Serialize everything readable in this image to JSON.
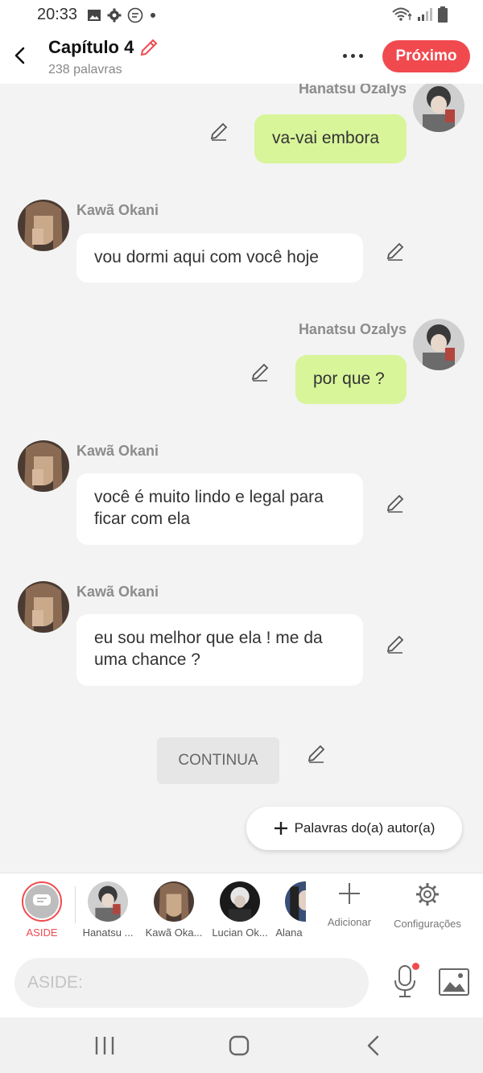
{
  "status_bar": {
    "time": "20:33"
  },
  "header": {
    "title": "Capítulo 4",
    "word_count": "238 palavras",
    "next_label": "Próximo"
  },
  "messages": [
    {
      "side": "right",
      "author": "Hanatsu Ozalys",
      "text": "va-vai embora"
    },
    {
      "side": "left",
      "author": "Kawã Okani",
      "text": "vou dormi aqui com você hoje"
    },
    {
      "side": "right",
      "author": "Hanatsu Ozalys",
      "text": "por que ?"
    },
    {
      "side": "left",
      "author": "Kawã Okani",
      "text": "você é muito lindo e legal para ficar com ela"
    },
    {
      "side": "left",
      "author": "Kawã Okani",
      "text": "eu sou melhor que ela ! me da uma chance ?"
    }
  ],
  "aside_text": "CONTINUA",
  "author_words_label": "Palavras do(a) autor(a)",
  "characters": [
    {
      "label": "ASIDE"
    },
    {
      "label": "Hanatsu ..."
    },
    {
      "label": "Kawã Oka..."
    },
    {
      "label": "Lucian Ok..."
    },
    {
      "label": "Alana"
    }
  ],
  "tools": {
    "add_label": "Adicionar",
    "settings_label": "Configurações"
  },
  "input": {
    "placeholder": "ASIDE:"
  },
  "colors": {
    "accent": "#f04a4f",
    "bubble_right": "#d8f59a",
    "bubble_left": "#ffffff"
  }
}
